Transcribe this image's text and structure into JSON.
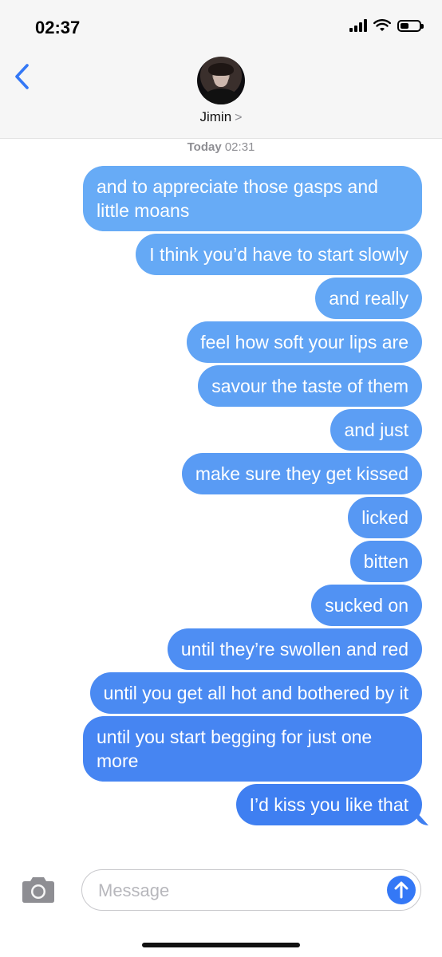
{
  "status_bar": {
    "time": "02:37"
  },
  "header": {
    "contact_name": "Jimin",
    "contact_chevron": ">"
  },
  "thread": {
    "timestamp_day": "Today",
    "timestamp_time": "02:31",
    "messages": [
      {
        "text": "and to appreciate those gasps and little moans",
        "color": "#67abf6"
      },
      {
        "text": "I think you’d have to start slowly",
        "color": "#65a9f5"
      },
      {
        "text": "and really",
        "color": "#63a7f5"
      },
      {
        "text": "feel how soft your lips are",
        "color": "#61a4f5"
      },
      {
        "text": "savour the taste of them",
        "color": "#5ea1f4"
      },
      {
        "text": "and just",
        "color": "#5c9ef4"
      },
      {
        "text": "make sure they get kissed",
        "color": "#599bf4"
      },
      {
        "text": "licked",
        "color": "#5798f3"
      },
      {
        "text": "bitten",
        "color": "#5495f3"
      },
      {
        "text": "sucked on",
        "color": "#5192f3"
      },
      {
        "text": "until they’re swollen and red",
        "color": "#4e8ef3"
      },
      {
        "text": "until you get all hot and bothered by it",
        "color": "#4a8af2"
      },
      {
        "text": "until you start begging for just one more",
        "color": "#4685f2"
      },
      {
        "text": "I’d kiss you like that",
        "color": "#3f7ff1"
      }
    ]
  },
  "composer": {
    "placeholder": "Message"
  },
  "colors": {
    "accent": "#3478f6",
    "header_bg": "#f6f6f6"
  },
  "icons": {
    "back": "chevron-left-icon",
    "camera": "camera-icon",
    "send": "arrow-up-icon"
  }
}
